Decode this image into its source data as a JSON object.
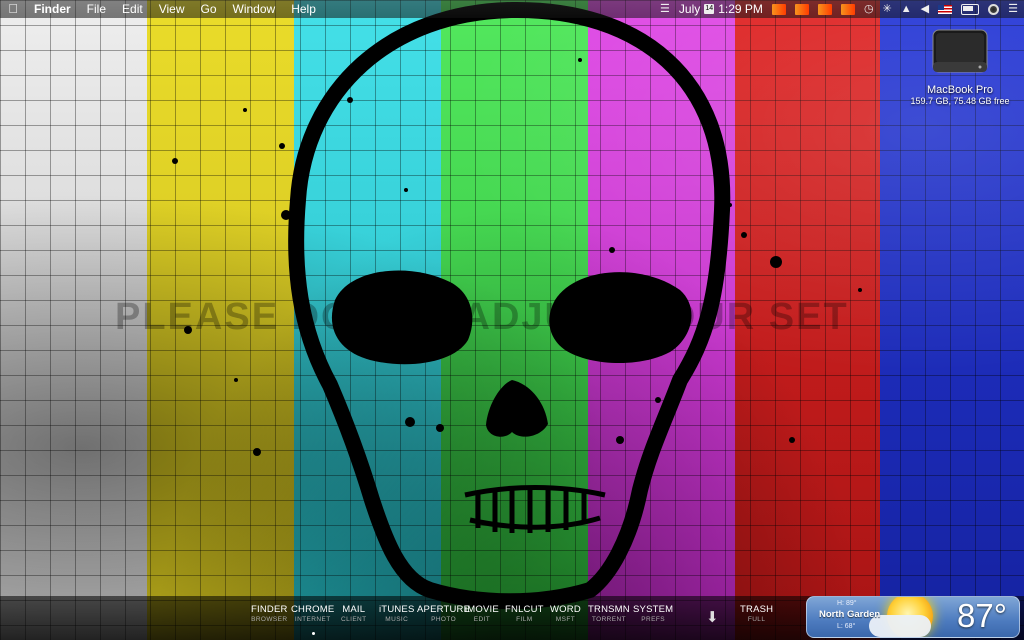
{
  "menubar": {
    "apple_icon": "apple-logo-icon",
    "items": [
      "Finder",
      "File",
      "Edit",
      "View",
      "Go",
      "Window",
      "Help"
    ],
    "clock": "July 1:29 PM",
    "calendar_day": "14"
  },
  "wallpaper": {
    "text": "PLEASE DO NOT ADJUST YOUR SET",
    "stripe_colors": [
      "#d9d9d9",
      "#e0d221",
      "#33d3dc",
      "#39d94a",
      "#d43ad9",
      "#d11d1d",
      "#1d2fc4"
    ]
  },
  "drive": {
    "name": "MacBook Pro",
    "info": "159.7 GB, 75.48 GB free"
  },
  "dock": {
    "items": [
      {
        "label": "FINDER",
        "sub": "BROWSER",
        "running": false
      },
      {
        "label": "CHROME",
        "sub": "INTERNET",
        "running": true
      },
      {
        "label": "MAIL",
        "sub": "CLIENT",
        "running": false
      },
      {
        "label": "iTUNES",
        "sub": "MUSIC",
        "running": false
      },
      {
        "label": "APERTURE",
        "sub": "PHOTO",
        "running": false
      },
      {
        "label": "iMOVIE",
        "sub": "EDIT",
        "running": false
      },
      {
        "label": "FNLCUT",
        "sub": "FILM",
        "running": false
      },
      {
        "label": "WORD",
        "sub": "MSFT",
        "running": false
      },
      {
        "label": "TRNSMN",
        "sub": "TORRENT",
        "running": false
      },
      {
        "label": "SYSTEM",
        "sub": "PREFS",
        "running": false
      }
    ],
    "downloads_icon": "download-arrow-icon",
    "trash": {
      "label": "TRASH",
      "sub": "FULL"
    }
  },
  "weather": {
    "hi": "H: 89°",
    "location": "North Garden",
    "lo": "L: 68°",
    "temp": "87°"
  }
}
